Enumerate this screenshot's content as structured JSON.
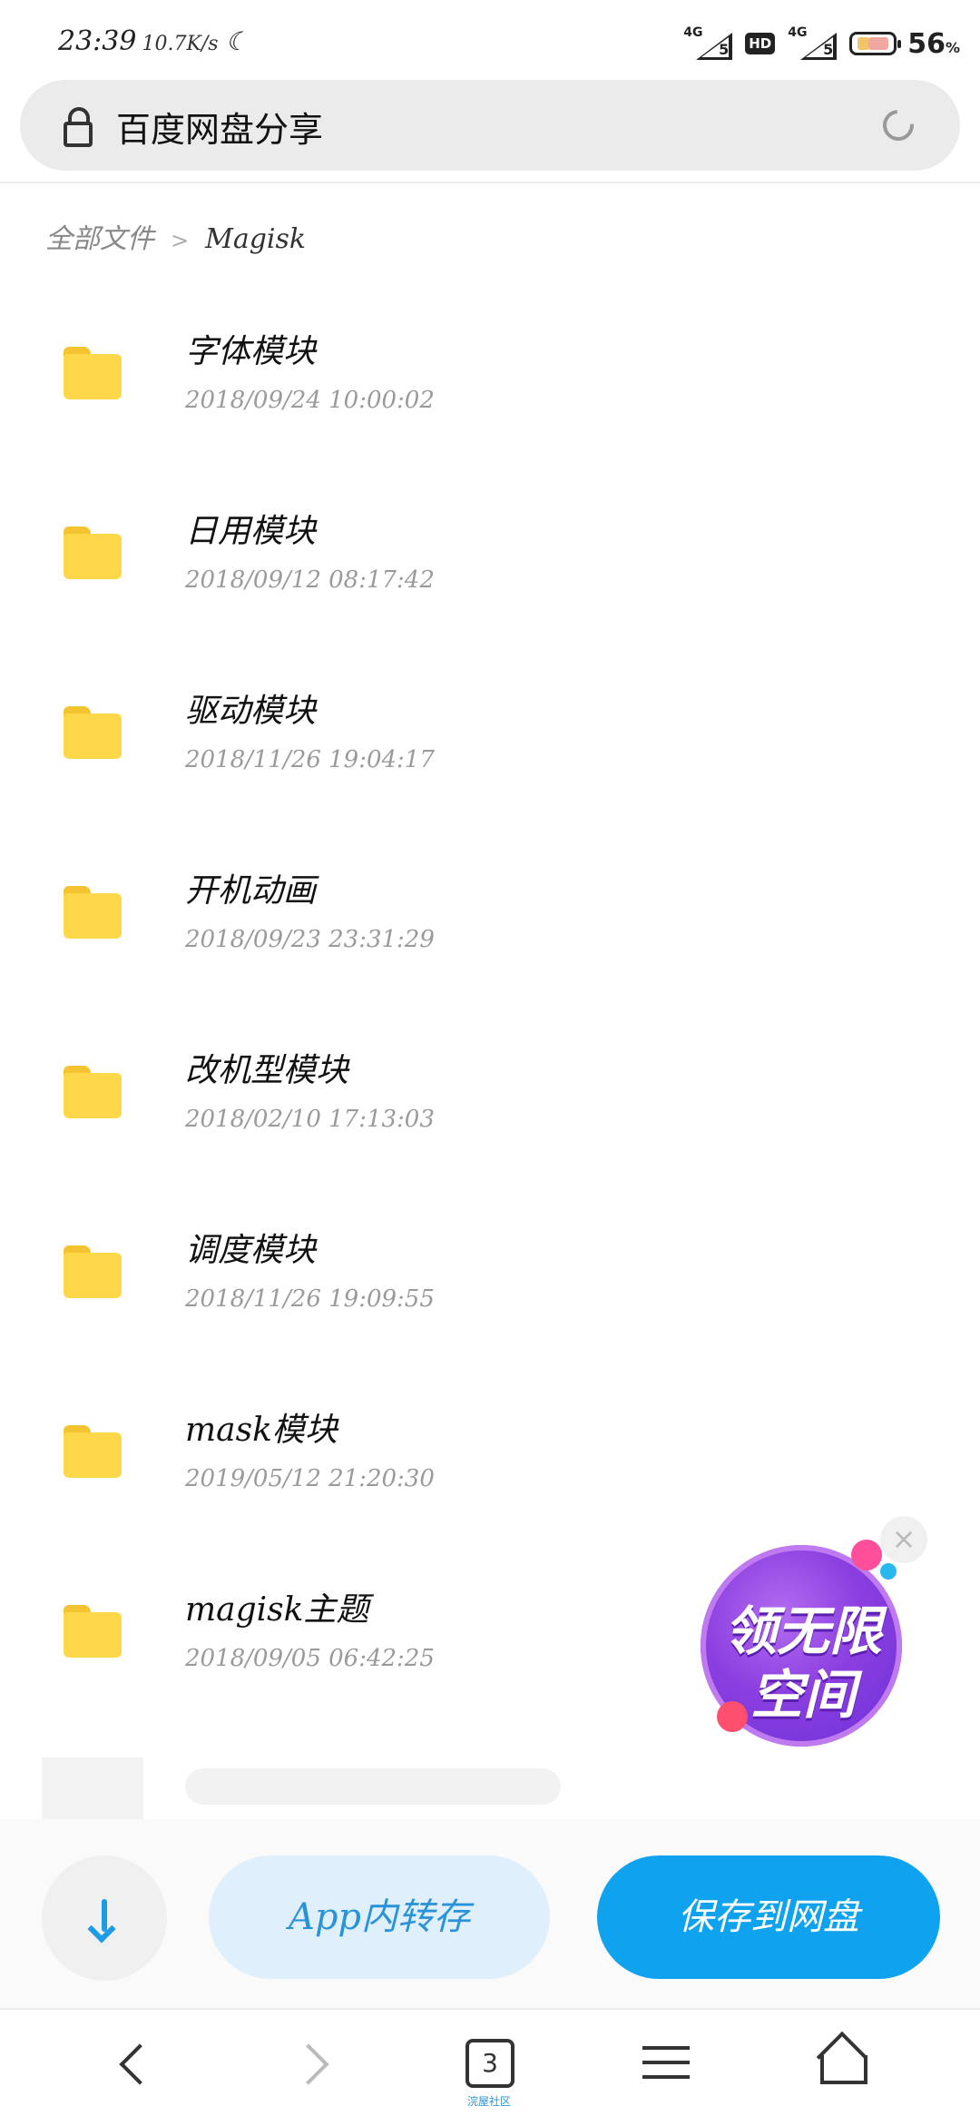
{
  "status_bar": {
    "time": "23:39",
    "net_speed": "10.7K/s",
    "moon_icon": "moon-icon",
    "signal_1": {
      "type": "4G",
      "bars": "5"
    },
    "hd_badge": "HD",
    "signal_2": {
      "type": "4G",
      "bars": "5"
    },
    "battery_percent": "56",
    "battery_unit": "%"
  },
  "address_bar": {
    "title": "百度网盘分享",
    "lock_icon": "lock-icon",
    "reload_icon": "reload-icon"
  },
  "breadcrumb": {
    "root": "全部文件",
    "separator": ">",
    "current": "Magisk"
  },
  "files": [
    {
      "name": "字体模块",
      "date": "2018/09/24 10:00:02"
    },
    {
      "name": "日用模块",
      "date": "2018/09/12 08:17:42"
    },
    {
      "name": "驱动模块",
      "date": "2018/11/26 19:04:17"
    },
    {
      "name": "开机动画",
      "date": "2018/09/23 23:31:29"
    },
    {
      "name": "改机型模块",
      "date": "2018/02/10 17:13:03"
    },
    {
      "name": "调度模块",
      "date": "2018/11/26 19:09:55"
    },
    {
      "name": "mask模块",
      "date": "2019/05/12 21:20:30"
    },
    {
      "name": "magisk主题",
      "date": "2018/09/05 06:42:25"
    }
  ],
  "promo": {
    "line1": "领无限",
    "line2": "空间",
    "close": "×"
  },
  "actions": {
    "download_icon": "download-icon",
    "app_save_label": "App内转存",
    "save_to_disk_label": "保存到网盘"
  },
  "nav": {
    "tab_count": "3",
    "tab_caption": "浣屋社区"
  },
  "colors": {
    "accent": "#0fa3ef",
    "folder": "#ffd84a",
    "promo": "#8b3fe0"
  }
}
